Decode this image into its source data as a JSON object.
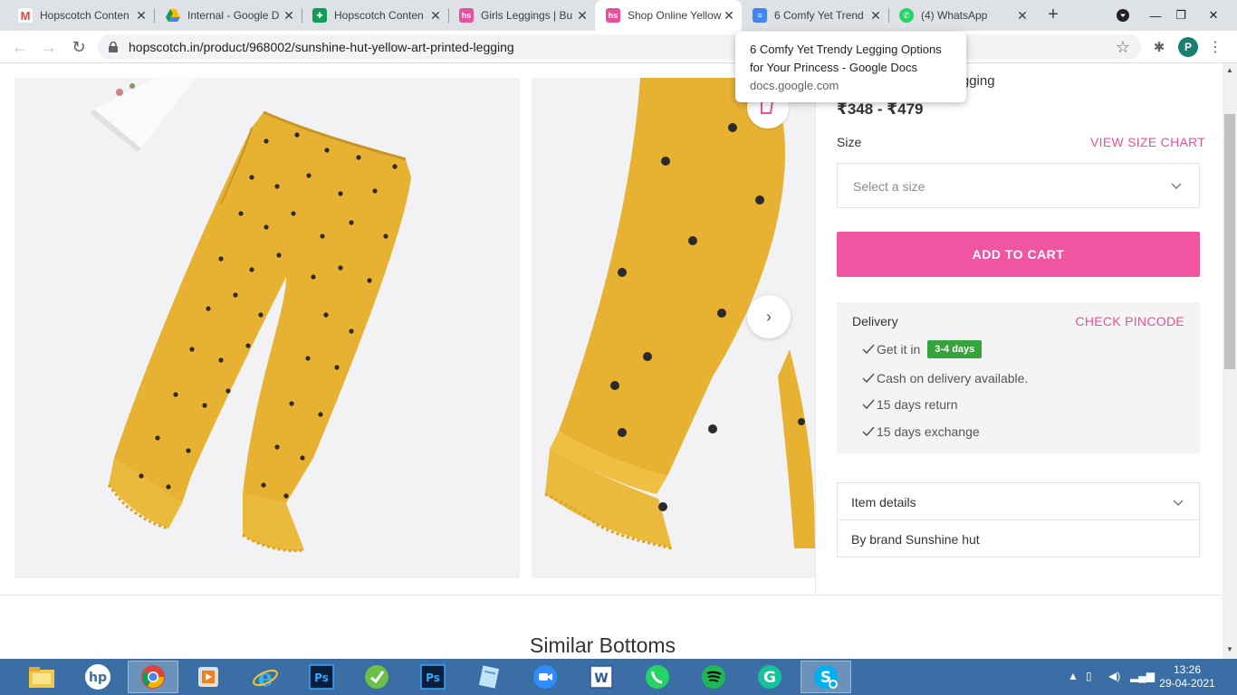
{
  "browser": {
    "tabs": [
      {
        "title": "Hopscotch Conten",
        "icon": "gmail-icon",
        "color": "#ea4335",
        "active": false
      },
      {
        "title": "Internal - Google D",
        "icon": "google-drive-icon",
        "color": "#fbbc04",
        "active": false
      },
      {
        "title": "Hopscotch Conten",
        "icon": "google-sheets-icon",
        "color": "#0f9d58",
        "active": false
      },
      {
        "title": "Girls Leggings | Bu",
        "icon": "hopscotch-icon",
        "color": "#e8509b",
        "active": false
      },
      {
        "title": "Shop Online Yellow",
        "icon": "hopscotch-icon",
        "color": "#e8509b",
        "active": true
      },
      {
        "title": "6 Comfy Yet Trend",
        "icon": "google-docs-icon",
        "color": "#4285f4",
        "active": false
      },
      {
        "title": "(4) WhatsApp",
        "icon": "whatsapp-icon",
        "color": "#25d366",
        "active": false
      }
    ],
    "url": "hopscotch.in/product/968002/sunshine-hut-yellow-art-printed-legging",
    "profile_initial": "P",
    "tooltip": {
      "title_line1": "6 Comfy Yet Trendy Legging Options",
      "title_line2": "for Your Princess - Google Docs",
      "domain": "docs.google.com"
    }
  },
  "product": {
    "title": "Yellow Art Printed Legging",
    "price": "₹348 - ₹479",
    "size_label": "Size",
    "size_chart_link": "VIEW SIZE CHART",
    "size_placeholder": "Select a size",
    "add_to_cart": "ADD TO CART",
    "delivery": {
      "heading": "Delivery",
      "check_pincode": "CHECK PINCODE",
      "get_it_in": "Get it in",
      "days_badge": "3-4 days",
      "cod": "Cash on delivery available.",
      "return": "15 days return",
      "exchange": "15 days exchange"
    },
    "item_details": "Item details",
    "brand_line": "By brand Sunshine hut"
  },
  "section": {
    "similar_title": "Similar Bottoms"
  },
  "taskbar": {
    "apps": [
      "file-explorer-icon",
      "hp-icon",
      "chrome-icon",
      "media-player-icon",
      "internet-explorer-icon",
      "photoshop-icon",
      "greenshot-icon",
      "photoshop-icon",
      "notepad-icon",
      "zoom-icon",
      "word-icon",
      "whatsapp-icon",
      "spotify-icon",
      "grammarly-icon",
      "skype-icon"
    ],
    "time": "13:26",
    "date": "29-04-2021"
  },
  "colors": {
    "brand_pink": "#ef55a0",
    "legging_yellow": "#e7b232",
    "badge_green": "#36a43c"
  }
}
